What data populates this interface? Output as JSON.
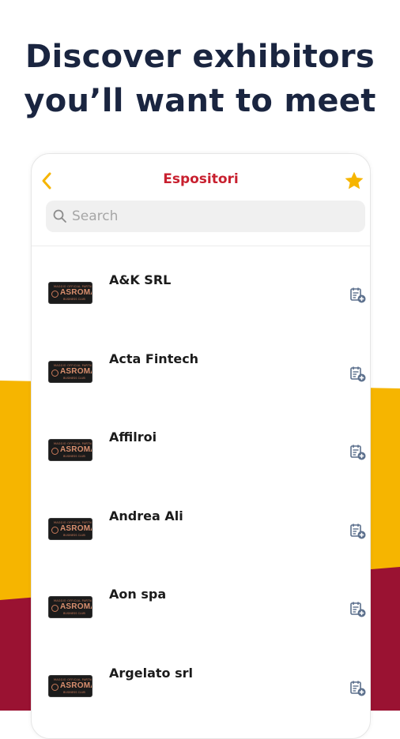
{
  "headline": {
    "line1": "Discover exhibitors",
    "line2": "you’ll want to meet"
  },
  "colors": {
    "headline": "#1a2540",
    "accent_gold": "#f6b500",
    "accent_red": "#9a1232",
    "title_red": "#c8202f",
    "icon_blue": "#5b6f8c"
  },
  "app": {
    "title": "Espositori",
    "back_icon": "chevron-left-icon",
    "favorite_icon": "star-icon"
  },
  "search": {
    "placeholder": "Search",
    "value": ""
  },
  "exhibitors": [
    {
      "name": "A&K SRL",
      "logo": {
        "top": "MAGGIO OFFICIAL PARTNER",
        "main": "ASROMA",
        "sub": "BUSINESS CLUB"
      }
    },
    {
      "name": "Acta Fintech",
      "logo": {
        "top": "MAGGIO OFFICIAL PARTNER",
        "main": "ASROMA",
        "sub": "BUSINESS CLUB"
      }
    },
    {
      "name": "Affilroi",
      "logo": {
        "top": "MAGGIO OFFICIAL PARTNER",
        "main": "ASROMA",
        "sub": "BUSINESS CLUB"
      }
    },
    {
      "name": "Andrea Ali",
      "logo": {
        "top": "MAGGIO OFFICIAL PARTNER",
        "main": "ASROMA",
        "sub": "BUSINESS CLUB"
      }
    },
    {
      "name": "Aon spa",
      "logo": {
        "top": "MAGGIO OFFICIAL PARTNER",
        "main": "ASROMA",
        "sub": "BUSINESS CLUB"
      }
    },
    {
      "name": "Argelato srl",
      "logo": {
        "top": "MAGGIO OFFICIAL PARTNER",
        "main": "ASROMA",
        "sub": "BUSINESS CLUB"
      }
    }
  ]
}
